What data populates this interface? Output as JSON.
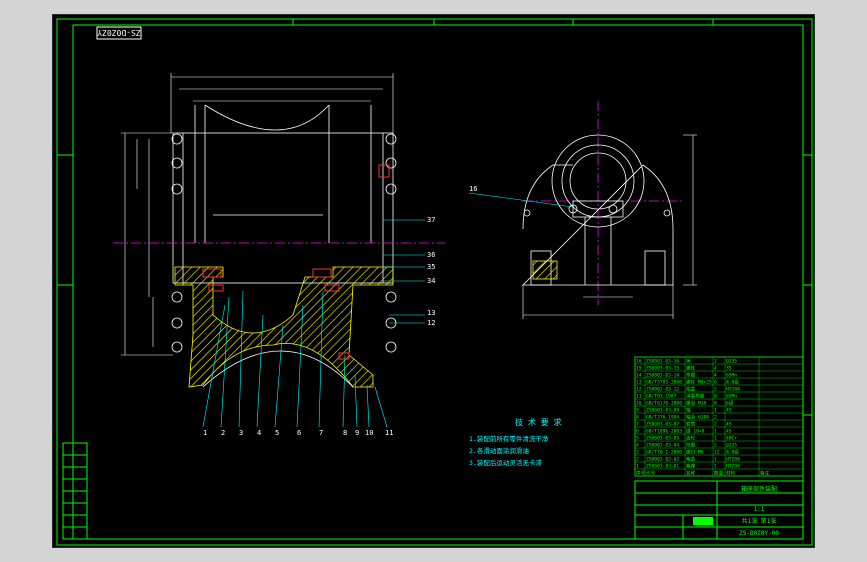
{
  "drawing": {
    "stamp_code": "ZS-D0Z0ZY",
    "frame_color": "#00ff00",
    "line_color": "#ffffff",
    "dim_color": "#00ffff",
    "center_color": "#ff00ff",
    "hatch_color": "#ffff00",
    "balloons_section": [
      "1",
      "2",
      "3",
      "4",
      "5",
      "6",
      "7",
      "8",
      "9",
      "10",
      "11"
    ],
    "balloons_right": [
      "37",
      "36",
      "35",
      "34",
      "13",
      "12"
    ],
    "balloon_side": "16",
    "tech_title": "技 术 要 求",
    "tech_lines": [
      "1.装配前所有零件清洗干净",
      "2.各滑动面涂润滑油",
      "3.装配后运动灵活无卡滞"
    ],
    "title_block": {
      "name": "箱座部件装配",
      "drawing_no": "ZS-D0Z0Y-00",
      "scale": "1:1",
      "sheet": "共1张 第1张"
    },
    "bom_rows": [
      [
        "16",
        "ZS0003-03-16",
        "销",
        "2",
        "Q235",
        ""
      ],
      [
        "15",
        "ZS0003-03-15",
        "螺栓",
        "4",
        "35",
        ""
      ],
      [
        "14",
        "ZS0003-03-14",
        "垫圈",
        "4",
        "65Mn",
        ""
      ],
      [
        "13",
        "GB/T5783-2000",
        "螺栓 M8×25",
        "6",
        "8.8级",
        ""
      ],
      [
        "12",
        "ZS0003-03-12",
        "端盖",
        "2",
        "HT200",
        ""
      ],
      [
        "11",
        "GB/T93-1987",
        "弹簧垫圈",
        "8",
        "65Mn",
        ""
      ],
      [
        "10",
        "GB/T6170-2000",
        "螺母 M10",
        "8",
        "6级",
        ""
      ],
      [
        "9",
        "ZS0003-03-09",
        "轴",
        "1",
        "45",
        ""
      ],
      [
        "8",
        "GB/T276-1994",
        "轴承 6208",
        "2",
        "",
        ""
      ],
      [
        "7",
        "ZS0003-03-07",
        "套筒",
        "2",
        "45",
        ""
      ],
      [
        "6",
        "GB/T1096-2003",
        "键 10×8",
        "1",
        "45",
        ""
      ],
      [
        "5",
        "ZS0003-03-05",
        "齿轮",
        "1",
        "40Cr",
        ""
      ],
      [
        "4",
        "ZS0003-03-04",
        "挡圈",
        "2",
        "Q235",
        ""
      ],
      [
        "3",
        "GB/T70.1-2000",
        "螺钉 M6",
        "12",
        "8.8级",
        ""
      ],
      [
        "2",
        "ZS0003-03-02",
        "箱盖",
        "1",
        "HT200",
        ""
      ],
      [
        "1",
        "ZS0003-03-01",
        "箱座",
        "1",
        "HT200",
        ""
      ]
    ],
    "bom_header": [
      "序号",
      "代号",
      "名称",
      "数量",
      "材料",
      "备注"
    ]
  }
}
